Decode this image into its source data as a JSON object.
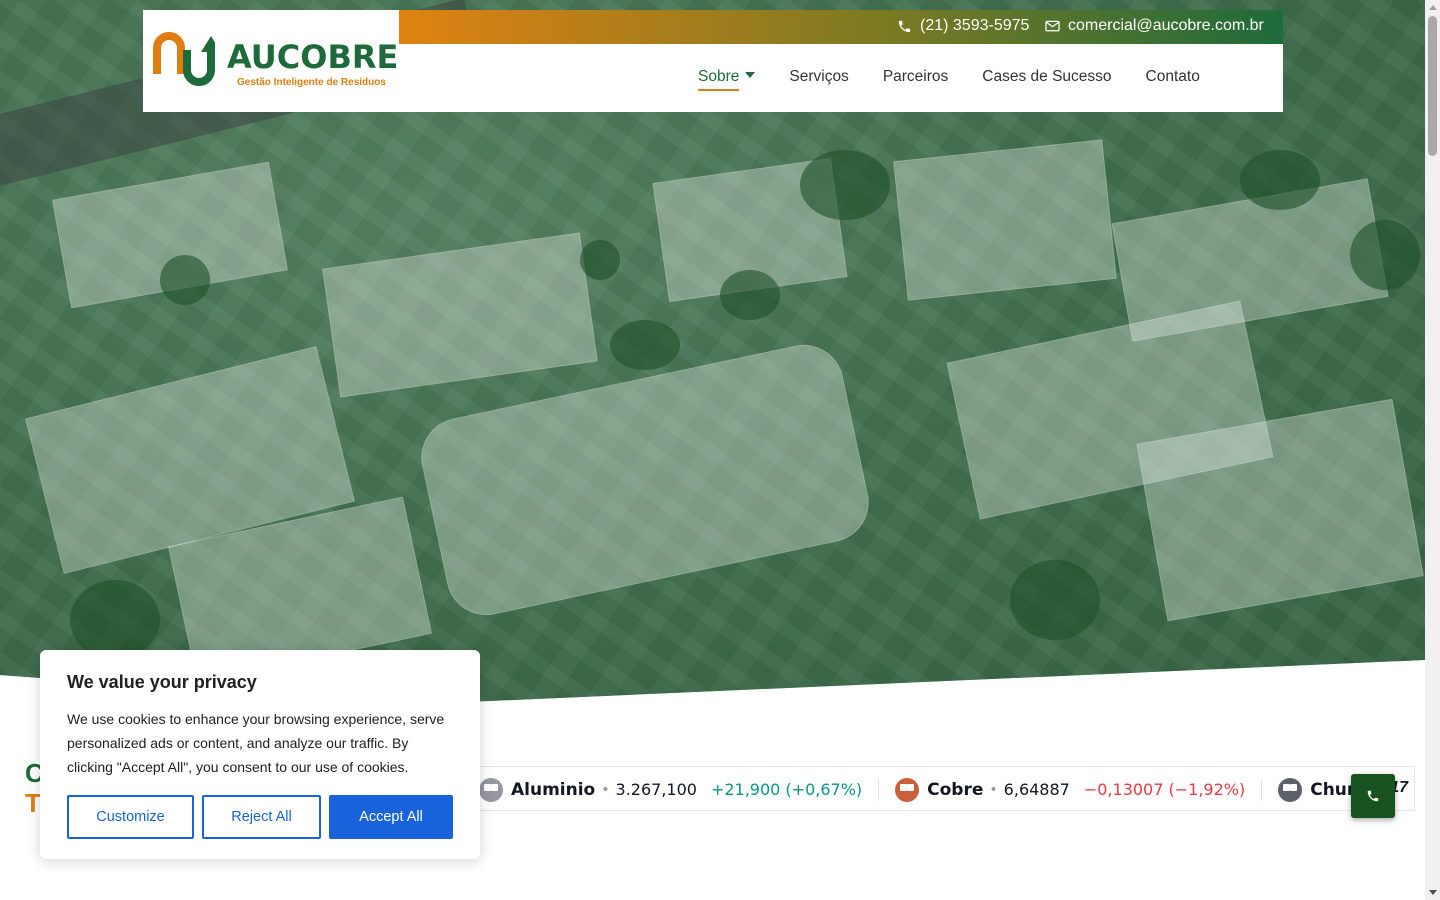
{
  "brand": {
    "name": "AUCOBRE",
    "tagline": "Gestão Inteligente de Resíduos",
    "primary_color": "#1d6a3a",
    "accent_color": "#e07d10"
  },
  "topbar": {
    "phone": "(21) 3593-5975",
    "email": "comercial@aucobre.com.br",
    "phone_icon": "phone-icon",
    "email_icon": "envelope-icon"
  },
  "nav": {
    "items": [
      {
        "label": "Sobre",
        "active": true,
        "has_dropdown": true
      },
      {
        "label": "Serviços"
      },
      {
        "label": "Parceiros"
      },
      {
        "label": "Cases de Sucesso"
      },
      {
        "label": "Contato"
      }
    ]
  },
  "section": {
    "heading_line1": "C",
    "heading_line2": "T"
  },
  "ticker": {
    "items": [
      {
        "name": "Aluminio",
        "price": "3.267,100",
        "change": "+21,900 (+0,67%)",
        "direction": "up",
        "icon_color": "#9598a1"
      },
      {
        "name": "Cobre",
        "price": "6,64887",
        "change": "−0,13007 (−1,92%)",
        "direction": "down",
        "icon_color": "#c8603a"
      },
      {
        "name": "Chumb",
        "price": "",
        "change": "",
        "direction": "",
        "icon_color": "#5d606b"
      }
    ],
    "up_color": "#089981",
    "down_color": "#f23645",
    "brand_mark": "17"
  },
  "fab": {
    "icon": "phone-icon"
  },
  "cookie": {
    "title": "We value your privacy",
    "text": "We use cookies to enhance your browsing experience, serve personalized ads or content, and analyze our traffic. By clicking \"Accept All\", you consent to our use of cookies.",
    "customize_label": "Customize",
    "reject_label": "Reject All",
    "accept_label": "Accept All",
    "accent_color": "#1863dc"
  }
}
